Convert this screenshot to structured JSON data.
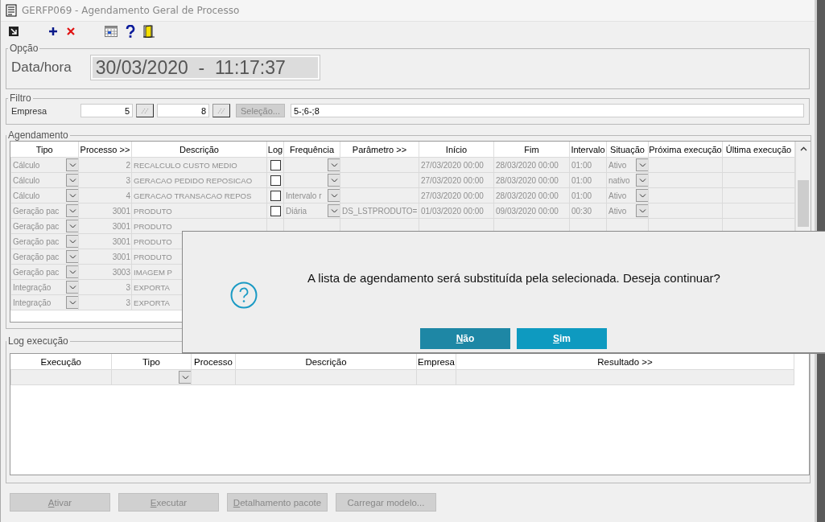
{
  "window": {
    "title": "GERFP069 - Agendamento Geral de Processo"
  },
  "opcao": {
    "title": "Opção",
    "label": "Data/hora",
    "value": "30/03/2020  -  11:17:37"
  },
  "filtro": {
    "title": "Filtro",
    "label": "Empresa",
    "from": "5",
    "to": "8",
    "selection_button": "Seleção...",
    "selection": "5-;6-;8"
  },
  "agendamento": {
    "title": "Agendamento",
    "columns": [
      "Tipo",
      "Processo >>",
      "Descrição",
      "Log",
      "Frequência",
      "Parâmetro >>",
      "Início",
      "Fim",
      "Intervalo",
      "Situação",
      "Próxima execução",
      "Última execução"
    ],
    "rows": [
      {
        "tipo": "Cálculo",
        "processo": "2",
        "descricao": "RECALCULO CUSTO MEDIO",
        "log_checked": false,
        "inicio": "27/03/2020 00:00",
        "fim": "28/03/2020 00:00",
        "intervalo": "01:00",
        "situacao": "Ativo"
      },
      {
        "tipo": "Cálculo",
        "processo": "3",
        "descricao": "GERACAO PEDIDO REPOSICAO",
        "log_checked": false,
        "inicio": "27/03/2020 00:00",
        "fim": "28/03/2020 00:00",
        "intervalo": "01:00",
        "situacao": "nativo"
      },
      {
        "tipo": "Cálculo",
        "processo": "4",
        "descricao": "GERACAO TRANSACAO REPOS",
        "log_checked": false,
        "frequencia": "Intervalo r",
        "inicio": "27/03/2020 00:00",
        "fim": "28/03/2020 00:00",
        "intervalo": "01:00",
        "situacao": "Ativo"
      },
      {
        "tipo": "Geração pac",
        "processo": "3001",
        "descricao": "PRODUTO",
        "log_checked": false,
        "frequencia": "Diária",
        "parametro": "DS_LSTPRODUTO=",
        "inicio": "01/03/2020 00:00",
        "fim": "09/03/2020 00:00",
        "intervalo": "00:30",
        "situacao": "Ativo"
      },
      {
        "tipo": "Geração pac",
        "processo": "3001",
        "descricao": "PRODUTO"
      },
      {
        "tipo": "Geração pac",
        "processo": "3001",
        "descricao": "PRODUTO"
      },
      {
        "tipo": "Geração pac",
        "processo": "3001",
        "descricao": "PRODUTO"
      },
      {
        "tipo": "Geração pac",
        "processo": "3003",
        "descricao": "IMAGEM P"
      },
      {
        "tipo": "Integração",
        "processo": "3",
        "descricao": "EXPORTA"
      },
      {
        "tipo": "Integração",
        "processo": "3",
        "descricao": "EXPORTA"
      }
    ]
  },
  "log": {
    "title": "Log execução",
    "columns": [
      "Execução",
      "Tipo",
      "Processo",
      "Descrição",
      "Empresa",
      "Resultado >>"
    ]
  },
  "buttons": [
    {
      "label": "Ativar",
      "underline_first": true
    },
    {
      "label": "Executar",
      "underline_first": true
    },
    {
      "label": "Detalhamento pacote",
      "underline_first": true
    },
    {
      "label": "Carregar modelo...",
      "underline_first": false
    }
  ],
  "dialog": {
    "message": "A lista de agendamento será substituída pela selecionada. Deseja continuar?",
    "buttons": [
      {
        "label": "Não",
        "underline_first": true,
        "selected": true
      },
      {
        "label": "Sim",
        "underline_first": true,
        "selected": false
      }
    ]
  }
}
